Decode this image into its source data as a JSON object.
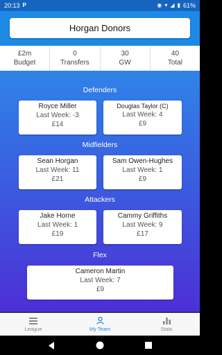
{
  "status_bar": {
    "time": "20:13",
    "carrier_icon": "P",
    "battery": "61%"
  },
  "header": {
    "team_name": "Horgan Donors"
  },
  "stats": [
    {
      "value": "£2m",
      "label": "Budget"
    },
    {
      "value": "0",
      "label": "Transfers"
    },
    {
      "value": "30",
      "label": "GW"
    },
    {
      "value": "40",
      "label": "Total"
    }
  ],
  "sections": {
    "defenders": "Defenders",
    "midfielders": "Midfielders",
    "attackers": "Attackers",
    "flex": "Flex"
  },
  "players": {
    "def1": {
      "name": "Royce Miller",
      "last_week": "Last Week: -3",
      "price": "£14"
    },
    "def2": {
      "name": "Douglas Taylor (C)",
      "last_week": "Last Week: 4",
      "price": "£9"
    },
    "mid1": {
      "name": "Sean Horgan",
      "last_week": "Last Week: 11",
      "price": "£21"
    },
    "mid2": {
      "name": "Sam Owen-Hughes",
      "last_week": "Last Week: 1",
      "price": "£9"
    },
    "att1": {
      "name": "Jake Horne",
      "last_week": "Last Week: 1",
      "price": "£19"
    },
    "att2": {
      "name": "Cammy Griffiths",
      "last_week": "Last Week: 9",
      "price": "£17"
    },
    "flex1": {
      "name": "Cameron Martin",
      "last_week": "Last Week: 7",
      "price": "£9"
    }
  },
  "bottom_nav": [
    {
      "label": "League",
      "icon": "list-icon"
    },
    {
      "label": "My Team",
      "icon": "person-icon"
    },
    {
      "label": "Stats",
      "icon": "bar-chart-icon"
    }
  ],
  "colors": {
    "header": "#1e88e5",
    "status": "#1565c0",
    "pitch_top": "#2f83e8",
    "pitch_bottom": "#4d2fd6",
    "active": "#1e88e5"
  }
}
